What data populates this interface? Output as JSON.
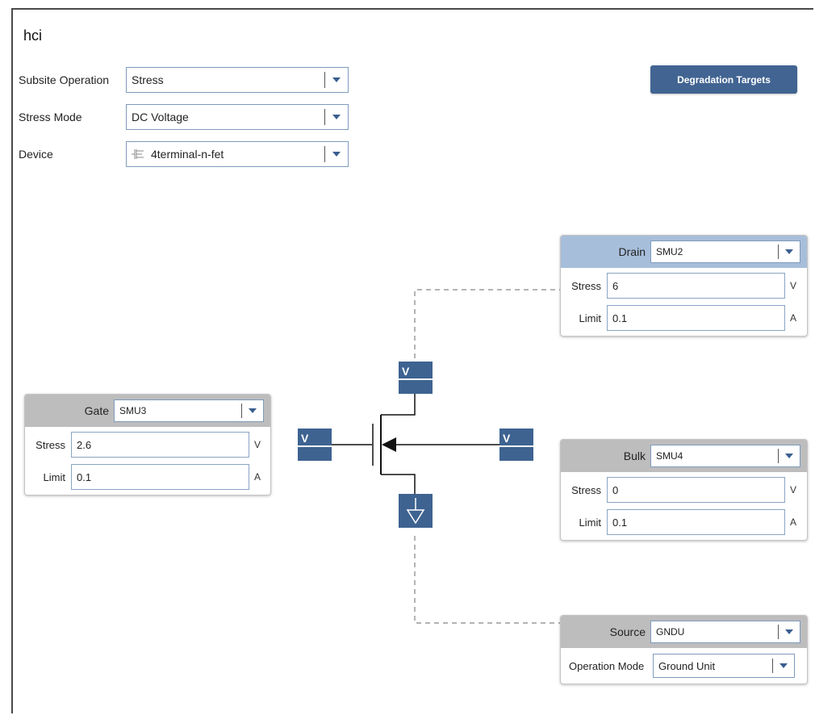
{
  "title": "hci",
  "form": {
    "subsite_operation": {
      "label": "Subsite Operation",
      "value": "Stress"
    },
    "stress_mode": {
      "label": "Stress Mode",
      "value": "DC Voltage"
    },
    "device": {
      "label": "Device",
      "value": "4terminal-n-fet",
      "icon": "fet-device-icon"
    }
  },
  "degradation_button": "Degradation Targets",
  "schematic": {
    "gate_source": "V",
    "drain_source": "V",
    "bulk_source": "V",
    "colors": {
      "block": "#3e6391",
      "line": "#111111",
      "dash": "#999999"
    }
  },
  "drain": {
    "title": "Drain",
    "smu": "SMU2",
    "stress": {
      "label": "Stress",
      "value": "6",
      "unit": "V"
    },
    "limit": {
      "label": "Limit",
      "value": "0.1",
      "unit": "A"
    }
  },
  "gate": {
    "title": "Gate",
    "smu": "SMU3",
    "stress": {
      "label": "Stress",
      "value": "2.6",
      "unit": "V"
    },
    "limit": {
      "label": "Limit",
      "value": "0.1",
      "unit": "A"
    }
  },
  "bulk": {
    "title": "Bulk",
    "smu": "SMU4",
    "stress": {
      "label": "Stress",
      "value": "0",
      "unit": "V"
    },
    "limit": {
      "label": "Limit",
      "value": "0.1",
      "unit": "A"
    }
  },
  "source": {
    "title": "Source",
    "smu": "GNDU",
    "operation_mode": {
      "label": "Operation Mode",
      "value": "Ground Unit"
    }
  }
}
